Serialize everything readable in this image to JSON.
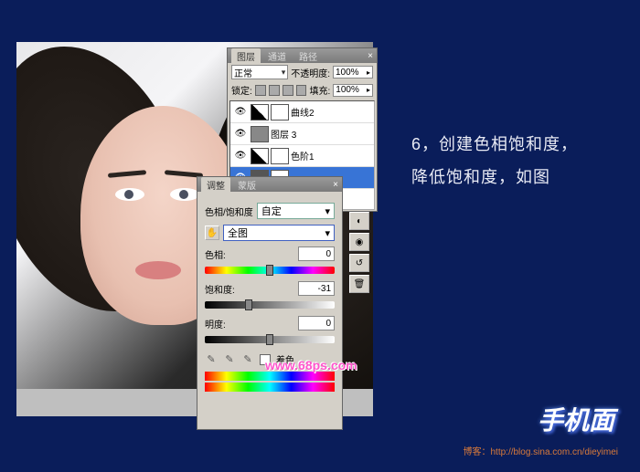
{
  "instruction": {
    "line1": "6，创建色相饱和度，",
    "line2": "降低饱和度，如图"
  },
  "watermark": "www.68ps.com",
  "logo": "手机面",
  "credit": {
    "label": "博客：",
    "url": "http://blog.sina.com.cn/dieyimei"
  },
  "layers_panel": {
    "tabs": [
      "图层",
      "通道",
      "路径"
    ],
    "blend_mode": "正常",
    "opacity_label": "不透明度:",
    "opacity_value": "100%",
    "lock_label": "锁定:",
    "fill_label": "填充:",
    "fill_value": "100%",
    "items": [
      {
        "name": "曲线2"
      },
      {
        "name": "图层 3"
      },
      {
        "name": "色阶1"
      },
      {
        "name": ""
      }
    ]
  },
  "hsl_panel": {
    "tabs": [
      "调整",
      "蒙版"
    ],
    "title": "色相/饱和度",
    "preset": "自定",
    "range_icon": "✋",
    "range": "全图",
    "hue_label": "色相:",
    "hue_value": "0",
    "sat_label": "饱和度:",
    "sat_value": "-31",
    "light_label": "明度:",
    "light_value": "0",
    "colorize_label": "着色"
  }
}
